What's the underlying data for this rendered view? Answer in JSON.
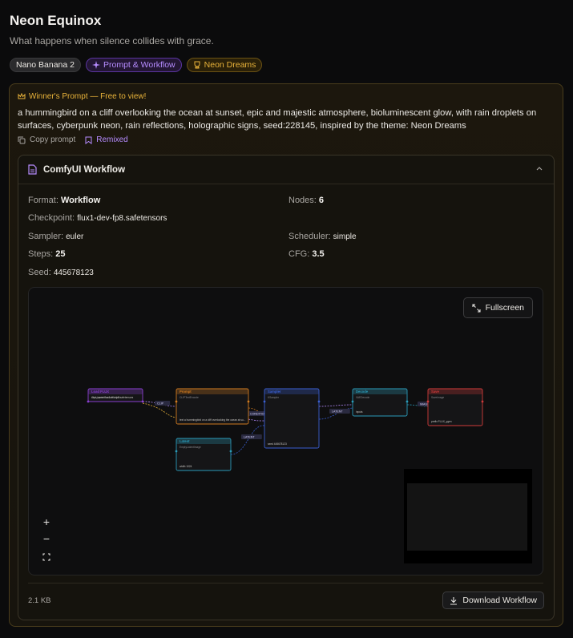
{
  "title": "Neon Equinox",
  "subtitle": "What happens when silence collides with grace.",
  "badges": {
    "model": "Nano Banana 2",
    "type": "Prompt & Workflow",
    "theme": "Neon Dreams"
  },
  "winner_label": "Winner's Prompt — Free to view!",
  "prompt_text": "a hummingbird on a cliff overlooking the ocean at sunset, epic and majestic atmosphere, bioluminescent glow, with rain droplets on surfaces, cyberpunk neon, rain reflections, holographic signs, seed:228145, inspired by the theme: Neon Dreams",
  "actions": {
    "copy": "Copy prompt",
    "remix": "Remixed"
  },
  "workflow": {
    "title": "ComfyUI Workflow",
    "format_label": "Format:",
    "format_value": "Workflow",
    "nodes_label": "Nodes:",
    "nodes_value": "6",
    "checkpoint_label": "Checkpoint:",
    "checkpoint_value": "flux1-dev-fp8.safetensors",
    "sampler_label": "Sampler:",
    "sampler_value": "euler",
    "scheduler_label": "Scheduler:",
    "scheduler_value": "simple",
    "steps_label": "Steps:",
    "steps_value": "25",
    "cfg_label": "CFG:",
    "cfg_value": "3.5",
    "seed_label": "Seed:",
    "seed_value": "445678123",
    "fullscreen_label": "Fullscreen",
    "zoom_in": "+",
    "zoom_out": "−",
    "file_size": "2.1 KB",
    "download_label": "Download Workflow"
  },
  "graph": {
    "nodes": [
      {
        "title": "Load FLUX",
        "sub": "CheckpointLoaderSimple",
        "field": "ckpt_name",
        "val": "flux1-dev-fp8.safetensors",
        "color": "#8a3fd0"
      },
      {
        "title": "Prompt",
        "sub": "CLIPTextEncode",
        "field": "text",
        "val": "a hummingbird on a cliff overlooking the ocean at su...",
        "color": "#d07a1f"
      },
      {
        "title": "Sampler",
        "sub": "KSampler",
        "field": "seed",
        "val": "445678123",
        "color": "#3a5fd0"
      },
      {
        "title": "Decode",
        "sub": "VAEDecode",
        "field": "inputs",
        "val": "",
        "color": "#2a9ab8"
      },
      {
        "title": "Save",
        "sub": "SaveImage",
        "field": "prefix",
        "val": "FLUX_ygen",
        "color": "#d03a3a"
      },
      {
        "title": "Latent",
        "sub": "EmptyLatentImage",
        "field": "width",
        "val": "1024",
        "color": "#2a9ab8"
      }
    ],
    "links": [
      "CLIP",
      "CONDITIONING",
      "LATENT",
      "IMAGE",
      "LATENT"
    ]
  },
  "colors": {
    "accent_purple": "#b68cff",
    "accent_gold": "#e9b33a"
  }
}
